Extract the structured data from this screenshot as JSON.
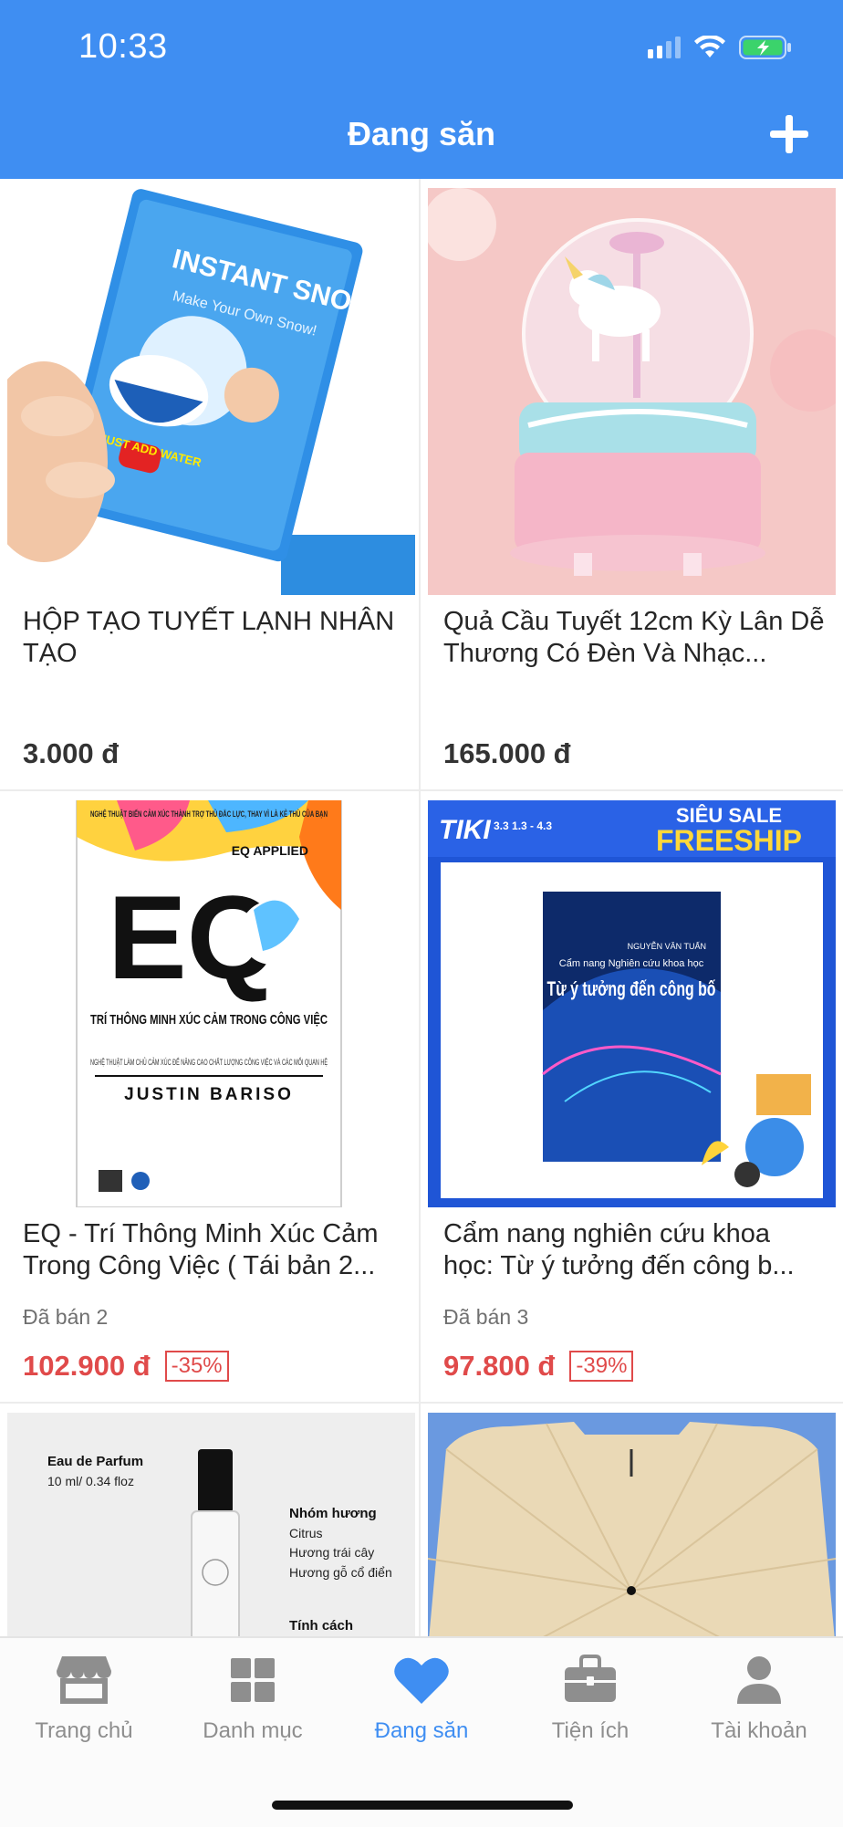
{
  "status_bar": {
    "time": "10:33"
  },
  "header": {
    "title": "Đang săn",
    "add_icon": "plus-icon"
  },
  "products": [
    {
      "name": "HỘP TẠO TUYẾT LẠNH NHÂN TẠO",
      "sold": "",
      "price": "3.000 đ",
      "discount": "",
      "image": "instant-snow-pack"
    },
    {
      "name": "Quả Cầu Tuyết 12cm Kỳ Lân Dễ Thương Có Đèn Và Nhạc...",
      "sold": "",
      "price": "165.000 đ",
      "discount": "",
      "image": "unicorn-snow-globe"
    },
    {
      "name": "EQ - Trí Thông Minh Xúc Cảm Trong Công Việc ( Tái bản 2...",
      "sold": "Đã bán 2",
      "price": "102.900 đ",
      "discount": "-35%",
      "image": "eq-book-cover"
    },
    {
      "name": "Cẩm nang nghiên cứu khoa học: Từ ý tưởng đến công b...",
      "sold": "Đã bán 3",
      "price": "97.800 đ",
      "discount": "-39%",
      "image": "research-handbook-cover"
    },
    {
      "name": "",
      "sold": "",
      "price": "",
      "discount": "",
      "image": "perfume-bottle"
    },
    {
      "name": "",
      "sold": "",
      "price": "",
      "discount": "",
      "image": "car-sunshade-umbrella"
    }
  ],
  "image_text": {
    "snow_title": "INSTANT SNOW",
    "snow_sub": "Make Your Own Snow!",
    "snow_badge": "JUST ADD WATER",
    "eq_top": "NGHỆ THUẬT BIẾN CẢM XÚC THÀNH TRỢ THỦ ĐẮC LỰC, THAY VÌ LÀ KẺ THÙ CỦA BẠN",
    "eq_applied": "EQ APPLIED",
    "eq_big": "EQ",
    "eq_title": "TRÍ THÔNG MINH XÚC CẢM TRONG CÔNG VIỆC",
    "eq_sub": "NGHỆ THUẬT LÀM CHỦ CẢM XÚC ĐỂ NÂNG CAO CHẤT LƯỢNG CÔNG VIỆC VÀ CÁC MỐI QUAN HỆ",
    "eq_author": "JUSTIN BARISO",
    "tiki_logo": "TIKI",
    "tiki_date": "3.3 1.3 - 4.3",
    "tiki_sale": "SIÊU SALE",
    "tiki_freeship": "FREESHIP",
    "book_author": "NGUYỄN VĂN TUẤN",
    "book_title1": "Cẩm nang Nghiên cứu khoa học",
    "book_title2": "Từ ý tưởng đến công bố",
    "perfume_type": "Eau de Parfum",
    "perfume_size": "10 ml/ 0.34 floz",
    "perfume_group": "Nhóm hương",
    "perfume_notes": [
      "Citrus",
      "Hương trái cây",
      "Hương gỗ cổ điển"
    ],
    "perfume_character": "Tính cách"
  },
  "tabbar": {
    "tabs": [
      {
        "label": "Trang chủ",
        "icon": "store-icon",
        "active": false
      },
      {
        "label": "Danh mục",
        "icon": "grid-icon",
        "active": false
      },
      {
        "label": "Đang săn",
        "icon": "heart-icon",
        "active": true
      },
      {
        "label": "Tiện ích",
        "icon": "briefcase-icon",
        "active": false
      },
      {
        "label": "Tài khoản",
        "icon": "person-icon",
        "active": false
      }
    ]
  },
  "colors": {
    "primary": "#3f8ef2",
    "sale": "#e04a4a",
    "inactive": "#8e8e8e"
  }
}
